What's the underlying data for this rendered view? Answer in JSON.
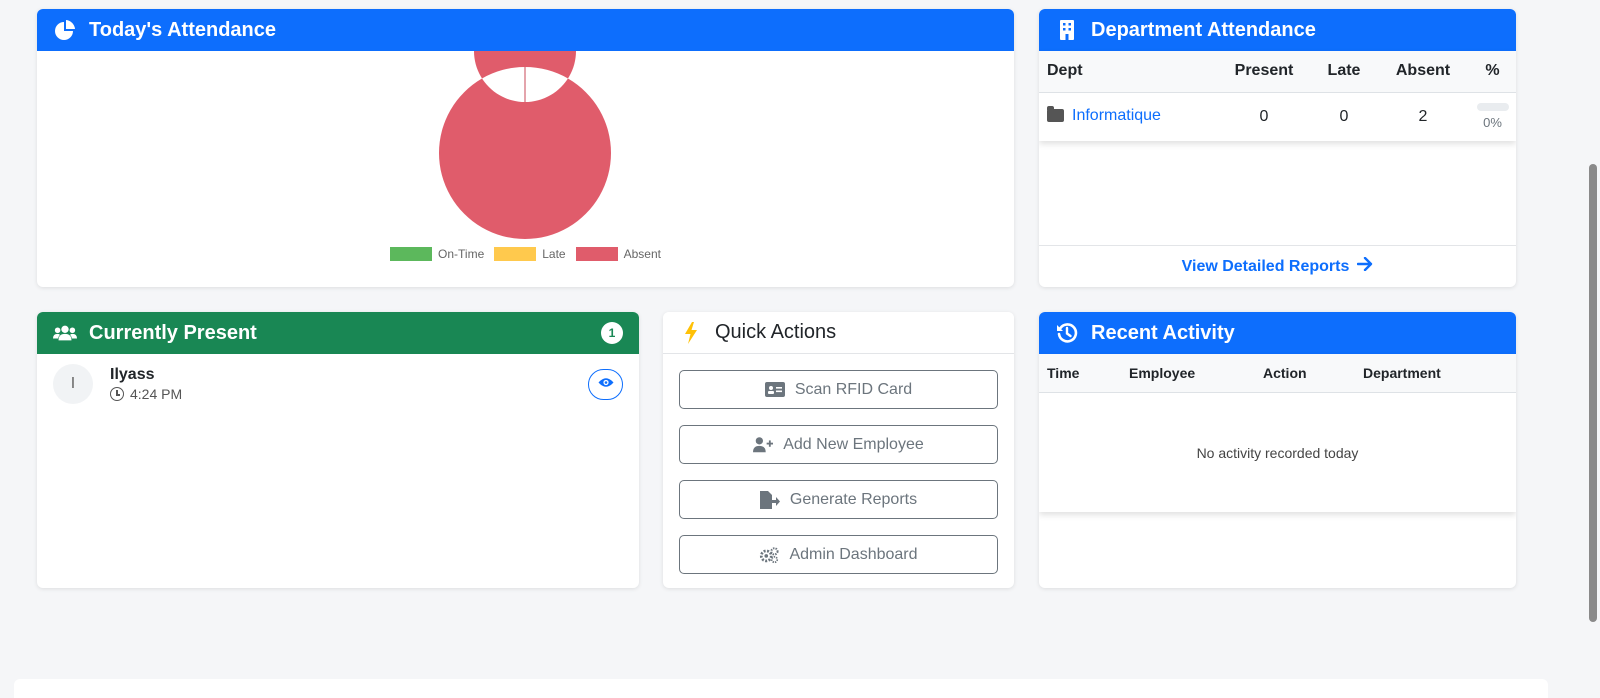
{
  "attendance": {
    "title": "Today's Attendance",
    "legend": [
      {
        "label": "On-Time",
        "color": "#5cb85c"
      },
      {
        "label": "Late",
        "color": "#ffc107"
      },
      {
        "label": "Absent",
        "color": "#e05c6b"
      }
    ],
    "chart_data": {
      "type": "pie",
      "categories": [
        "On-Time",
        "Late",
        "Absent"
      ],
      "values": [
        0,
        0,
        2
      ],
      "colors": [
        "#5cb85c",
        "#ffc107",
        "#e05c6b"
      ],
      "legend_position": "bottom"
    }
  },
  "department": {
    "title": "Department Attendance",
    "columns": [
      "Dept",
      "Present",
      "Late",
      "Absent",
      "%"
    ],
    "rows": [
      {
        "dept": "Informatique",
        "present": "0",
        "late": "0",
        "absent": "2",
        "percent": "0%",
        "progress": 0
      }
    ],
    "footer_link": "View Detailed Reports"
  },
  "present": {
    "title": "Currently Present",
    "count": "1",
    "people": [
      {
        "initial": "I",
        "name": "Ilyass",
        "time": "4:24 PM"
      }
    ]
  },
  "quick_actions": {
    "title": "Quick Actions",
    "buttons": [
      {
        "label": "Scan RFID Card",
        "icon": "id-card-icon"
      },
      {
        "label": "Add New Employee",
        "icon": "user-plus-icon"
      },
      {
        "label": "Generate Reports",
        "icon": "file-export-icon"
      },
      {
        "label": "Admin Dashboard",
        "icon": "cogs-icon"
      }
    ]
  },
  "recent": {
    "title": "Recent Activity",
    "columns": [
      "Time",
      "Employee",
      "Action",
      "Department"
    ],
    "empty_text": "No activity recorded today"
  },
  "colors": {
    "primary": "#0d6efd",
    "success": "#198754",
    "warning": "#ffc107",
    "absent": "#e05c6b"
  }
}
